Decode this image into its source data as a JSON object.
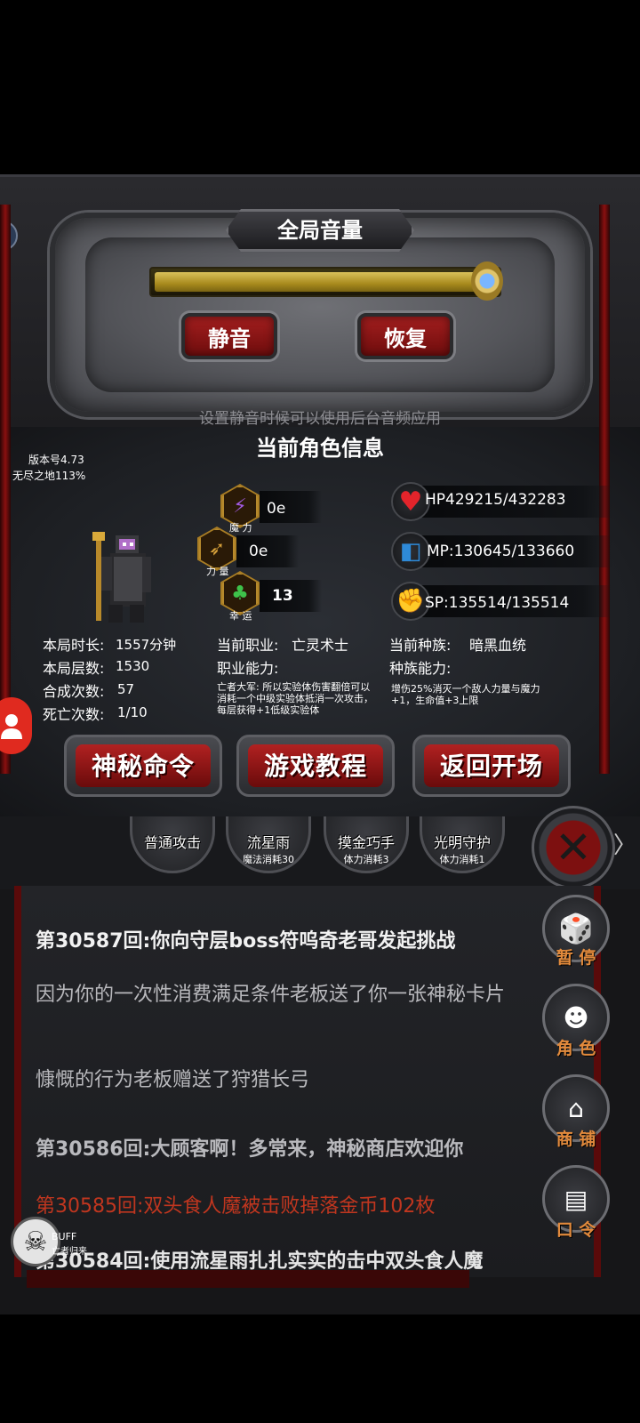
{
  "volume": {
    "title": "全局音量",
    "level": 0.97,
    "mute_label": "静音",
    "restore_label": "恢复",
    "hint": "设置静音时候可以使用后台音频应用"
  },
  "character": {
    "title": "当前角色信息",
    "version": "版本号4.73",
    "endless": "无尽之地113%",
    "magic_value": "0e",
    "magic_caption": "魔 力",
    "strength_value": "0e",
    "strength_caption": "力 量",
    "luck_value": "13",
    "luck_caption": "幸 运",
    "hp": "HP429215/432283",
    "mp": "MP:130645/133660",
    "sp": "SP:135514/135514",
    "play_time_label": "本局时长:",
    "play_time_value": "1557分钟",
    "floors_label": "本局层数:",
    "floors_value": "1530",
    "merges_label": "合成次数:",
    "merges_value": "57",
    "deaths_label": "死亡次数:",
    "deaths_value": "1/10",
    "class_label": "当前职业:",
    "class_value": "亡灵术士",
    "class_ability_label": "职业能力:",
    "class_ability_text": "亡者大军: 所以实验体伤害翻倍可以消耗一个中级实验体抵消一次攻击，每层获得+1低级实验体",
    "race_label": "当前种族:",
    "race_value": "暗黑血统",
    "race_ability_label": "种族能力:",
    "race_ability_text": "增伤25%消灭一个敌人力量与魔力+1，生命值+3上限"
  },
  "menu": {
    "secret_command": "神秘命令",
    "tutorial": "游戏教程",
    "return_start": "返回开场"
  },
  "skills": [
    {
      "name": "普通攻击",
      "cost": ""
    },
    {
      "name": "流星雨",
      "cost": "魔法消耗30"
    },
    {
      "name": "摸金巧手",
      "cost": "体力消耗3"
    },
    {
      "name": "光明守护",
      "cost": "体力消耗1"
    }
  ],
  "log": {
    "line1": "第30587回:你向守层boss符呜奇老哥发起挑战",
    "line2": "因为你的一次性消费满足条件老板送了你一张神秘卡片",
    "line3": "慷慨的行为老板赠送了狩猎长弓",
    "line4": "第30586回:大顾客啊！多常来，神秘商店欢迎你",
    "line5": "第30585回:双头食人魔被击败掉落金币102枚",
    "line6": "第30584回:使用流星雨扎扎实实的击中双头食人魔"
  },
  "side": {
    "pause": "暂 停",
    "character": "角 色",
    "shop": "商 铺",
    "command": "口 令"
  },
  "buff": {
    "label": "BUFF",
    "sub": "亡者归来"
  },
  "colors": {
    "accent_red": "#a31e1e",
    "gold": "#d9c05a",
    "side_label": "#e28a3c",
    "log_red": "#c0361f"
  },
  "icons": [
    "lightning-icon",
    "arrow-icon",
    "clover-icon",
    "heart-icon",
    "mana-icon",
    "stamina-icon",
    "dice-icon",
    "hooded-figure-icon",
    "shop-icon",
    "scroll-icon",
    "skull-icon",
    "close-icon"
  ]
}
